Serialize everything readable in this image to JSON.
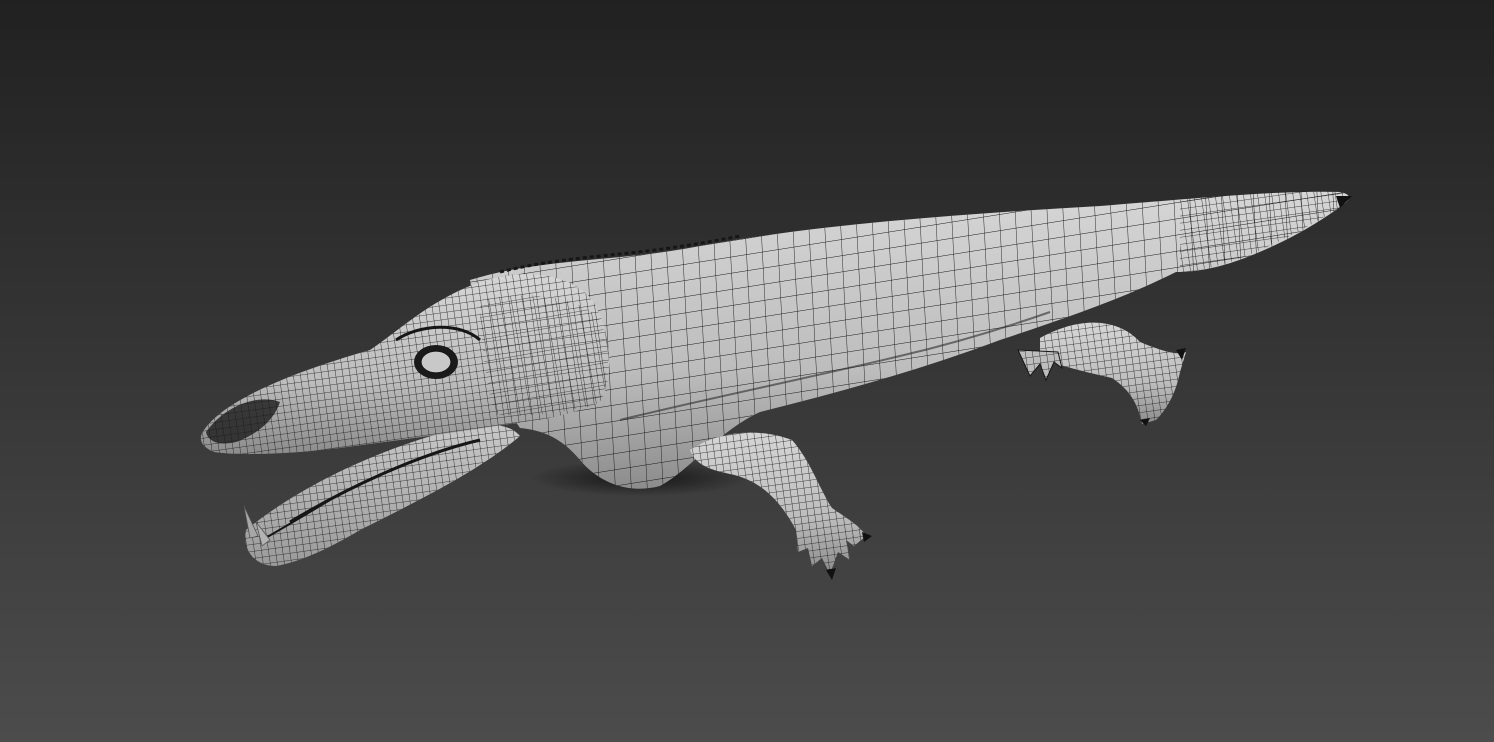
{
  "scene": {
    "subject": "crocodile",
    "render_style": "wireframe-over-shaded",
    "background_gradient": [
      "#212121",
      "#4c4c4c"
    ],
    "mesh_fill": "#c4c4c4",
    "wire_color": "#161616",
    "shadow_color": "#141414"
  }
}
